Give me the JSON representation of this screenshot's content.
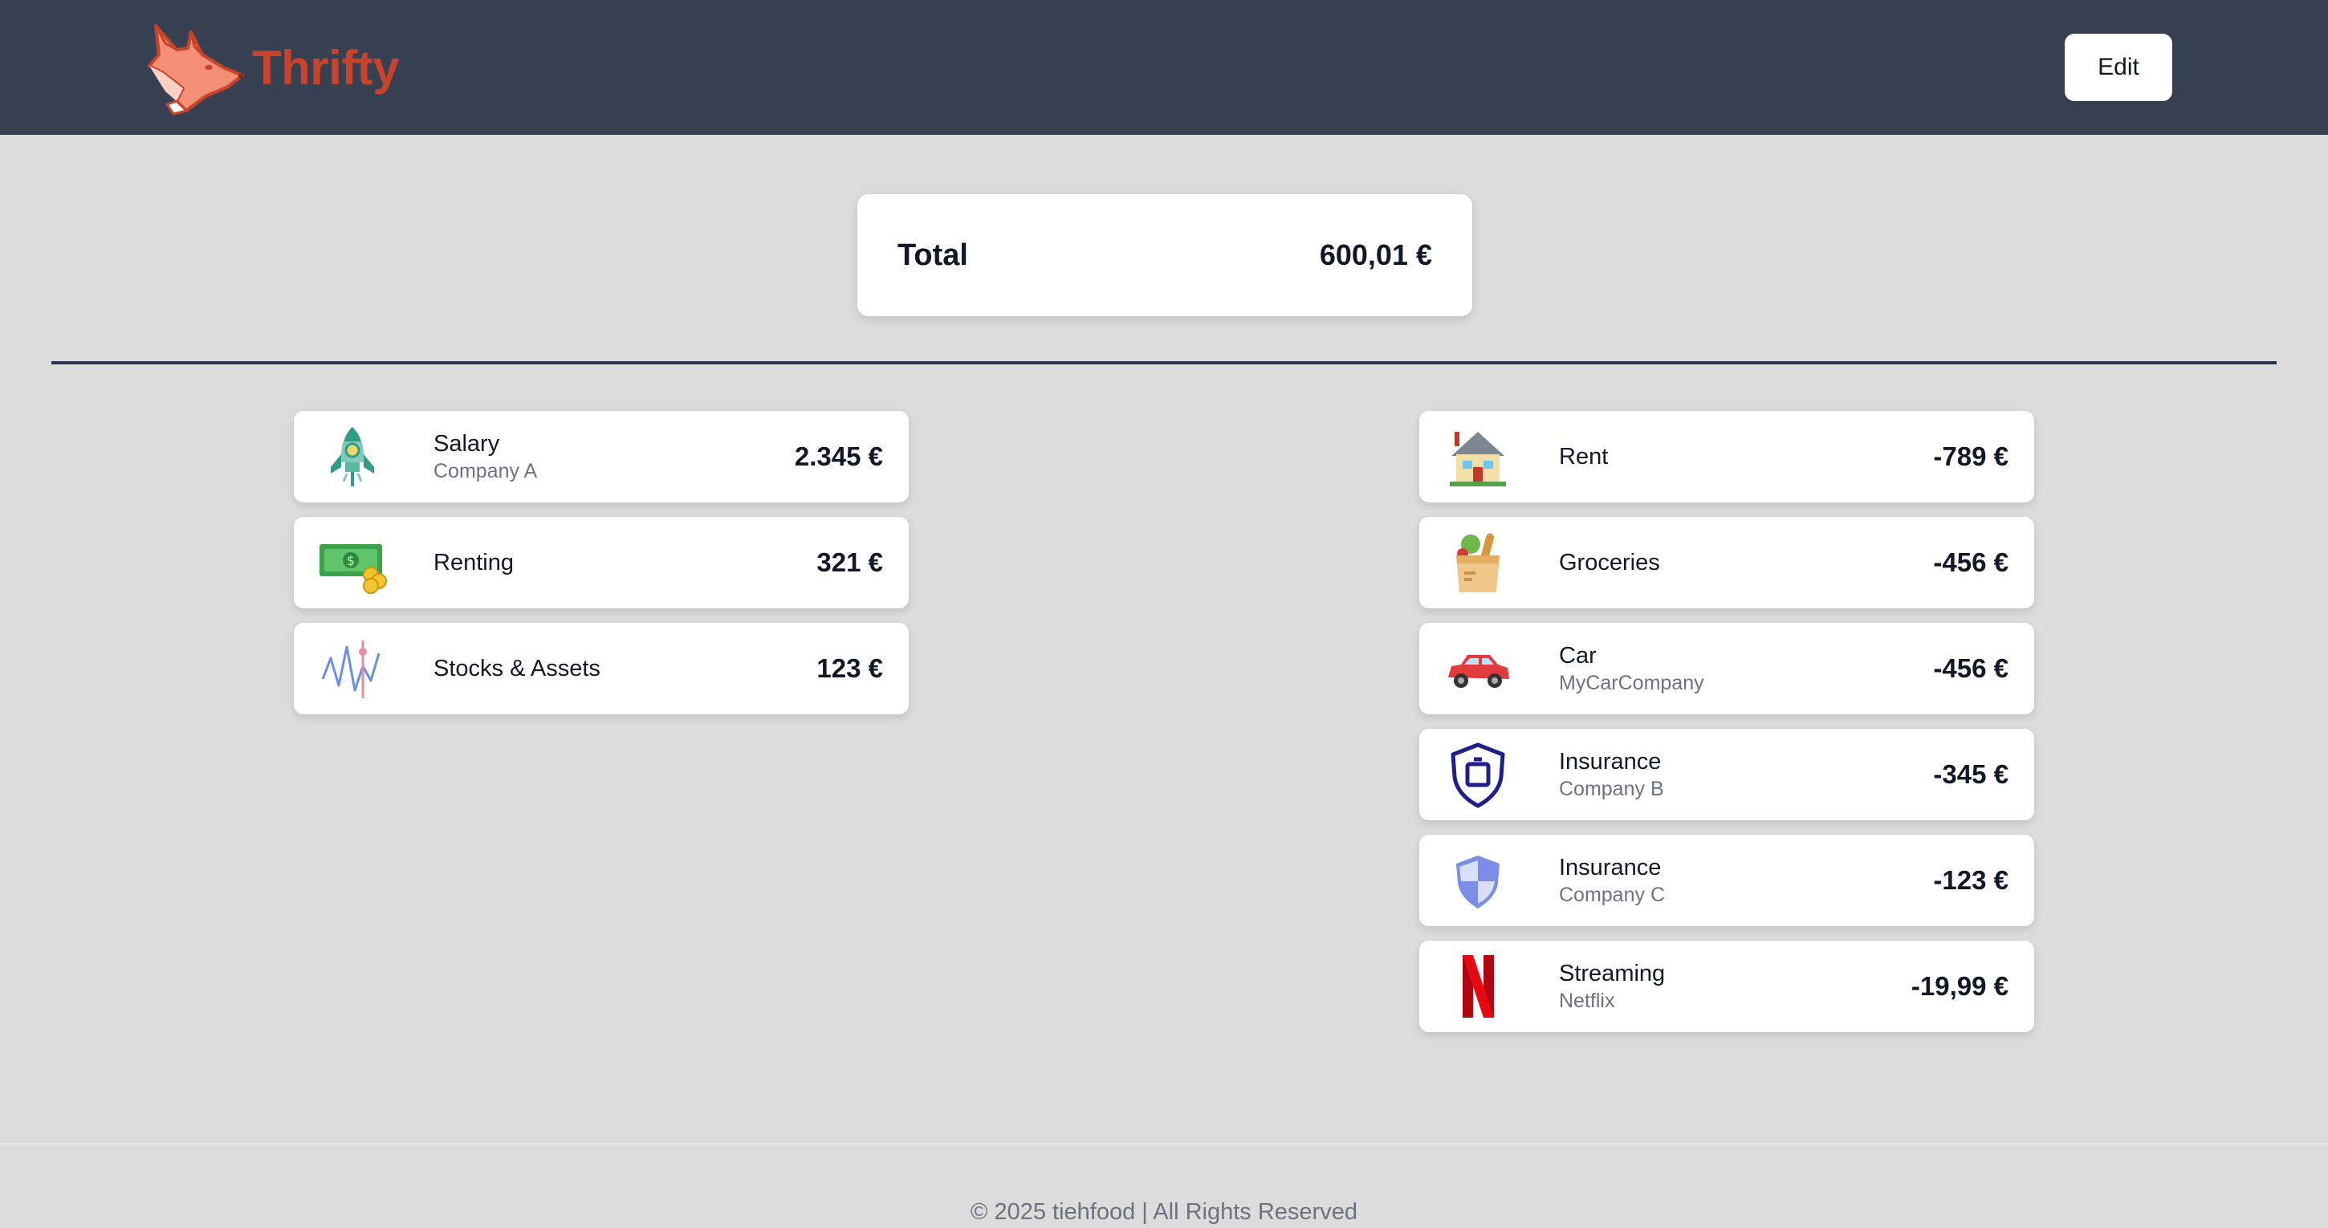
{
  "app": {
    "name": "Thrifty",
    "logo_icon": "fox-logo-icon"
  },
  "header": {
    "edit_label": "Edit"
  },
  "summary": {
    "label": "Total",
    "value": "600,01 €"
  },
  "income": [
    {
      "title": "Salary",
      "subtitle": "Company A",
      "amount": "2.345 €",
      "icon": "rocket-icon"
    },
    {
      "title": "Renting",
      "subtitle": "",
      "amount": "321 €",
      "icon": "money-icon"
    },
    {
      "title": "Stocks & Assets",
      "subtitle": "",
      "amount": "123 €",
      "icon": "stock-chart-icon"
    }
  ],
  "expenses": [
    {
      "title": "Rent",
      "subtitle": "",
      "amount": "-789 €",
      "icon": "house-icon"
    },
    {
      "title": "Groceries",
      "subtitle": "",
      "amount": "-456 €",
      "icon": "grocery-bag-icon"
    },
    {
      "title": "Car",
      "subtitle": "MyCarCompany",
      "amount": "-456 €",
      "icon": "car-icon"
    },
    {
      "title": "Insurance",
      "subtitle": "Company B",
      "amount": "-345 €",
      "icon": "shield-icon"
    },
    {
      "title": "Insurance",
      "subtitle": "Company C",
      "amount": "-123 €",
      "icon": "shield-half-icon"
    },
    {
      "title": "Streaming",
      "subtitle": "Netflix",
      "amount": "-19,99 €",
      "icon": "netflix-icon"
    }
  ],
  "footer": {
    "text": "© 2025 tiehfood | All Rights Reserved"
  }
}
